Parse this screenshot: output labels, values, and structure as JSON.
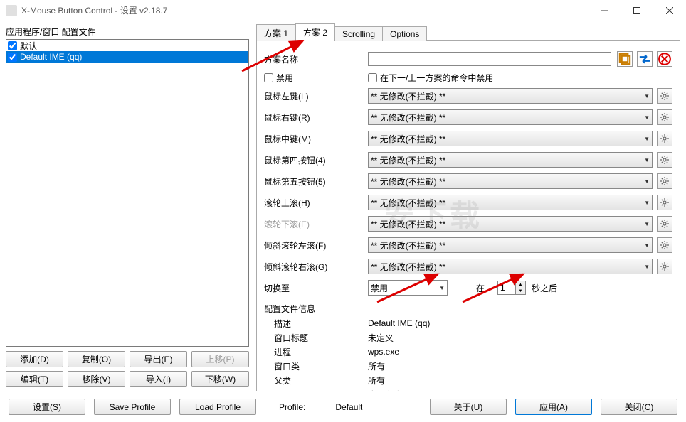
{
  "window": {
    "title": "X-Mouse Button Control - 设置 v2.18.7"
  },
  "left": {
    "caption": "应用程序/窗口 配置文件",
    "items": [
      {
        "label": "默认",
        "checked": true,
        "selected": false
      },
      {
        "label": "Default IME (qq)",
        "checked": true,
        "selected": true
      }
    ],
    "buttons": {
      "add": "添加(D)",
      "copy": "复制(O)",
      "export": "导出(E)",
      "up": "上移(P)",
      "edit": "编辑(T)",
      "remove": "移除(V)",
      "import": "导入(I)",
      "down": "下移(W)"
    }
  },
  "tabs": {
    "t1": "方案 1",
    "t2": "方案 2",
    "t3": "Scrolling",
    "t4": "Options",
    "active": 1
  },
  "form": {
    "name_label": "方案名称",
    "disable_label": "禁用",
    "disable_in_prev": "在下一/上一方案的命令中禁用",
    "rows": [
      {
        "label": "鼠标左键(L)",
        "value": "** 无修改(不拦截) **"
      },
      {
        "label": "鼠标右键(R)",
        "value": "** 无修改(不拦截) **"
      },
      {
        "label": "鼠标中键(M)",
        "value": "** 无修改(不拦截) **"
      },
      {
        "label": "鼠标第四按钮(4)",
        "value": "** 无修改(不拦截) **"
      },
      {
        "label": "鼠标第五按钮(5)",
        "value": "** 无修改(不拦截) **"
      },
      {
        "label": "滚轮上滚(H)",
        "value": "** 无修改(不拦截) **"
      },
      {
        "label": "滚轮下滚(E)",
        "value": "** 无修改(不拦截) **",
        "disabled": true
      },
      {
        "label": "倾斜滚轮左滚(F)",
        "value": "** 无修改(不拦截) **"
      },
      {
        "label": "倾斜滚轮右滚(G)",
        "value": "** 无修改(不拦截) **"
      }
    ],
    "switch_to": "切换至",
    "switch_value": "禁用",
    "at": "在",
    "seconds_value": "1",
    "seconds_after": "秒之后"
  },
  "info": {
    "header": "配置文件信息",
    "rows": [
      {
        "label": "描述",
        "value": "Default IME (qq)"
      },
      {
        "label": "窗口标题",
        "value": "未定义"
      },
      {
        "label": "进程",
        "value": "wps.exe"
      },
      {
        "label": "窗口类",
        "value": "所有"
      },
      {
        "label": "父类",
        "value": "所有"
      },
      {
        "label": "Match Type",
        "value": "应用程序"
      }
    ]
  },
  "footer": {
    "settings": "设置(S)",
    "save": "Save Profile",
    "load": "Load Profile",
    "profile_label": "Profile:",
    "profile_value": "Default",
    "about": "关于(U)",
    "apply": "应用(A)",
    "close": "关闭(C)"
  },
  "watermark": "安下载"
}
